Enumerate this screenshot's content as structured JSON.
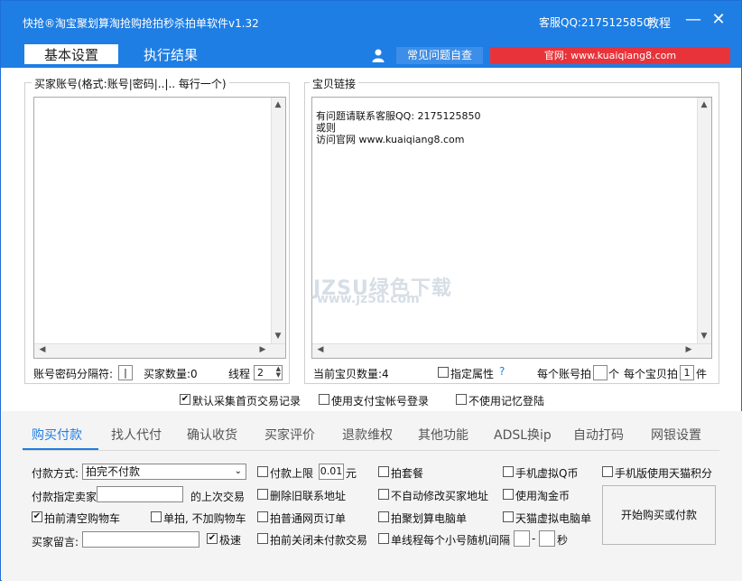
{
  "window": {
    "title": "快抢®淘宝聚划算淘抢购抢拍秒杀拍单软件v1.32",
    "support": "客服QQ:2175125850",
    "tutorial": "教程",
    "minimize": "—",
    "close": "✕"
  },
  "main_tabs": [
    {
      "label": "基本设置"
    },
    {
      "label": "执行结果"
    }
  ],
  "header_links": {
    "faq": "常见问题自查",
    "site": "官网: www.kuaiqiang8.com"
  },
  "accounts": {
    "legend": "买家账号(格式:账号|密码|..|.. 每行一个)",
    "content": "",
    "separator_label": "账号密码分隔符:",
    "separator_value": "|",
    "count_label": "买家数量:0",
    "threads_label": "线程",
    "threads_value": "2"
  },
  "links": {
    "legend": "宝贝链接",
    "content_lines": [
      "有问题请联系客服QQ: 2175125850",
      "或则",
      "访问官网 www.kuaiqiang8.com"
    ],
    "count_label": "当前宝贝数量:4",
    "attr_label": "指定属性",
    "attr_help": "?",
    "per_account_label": "每个账号拍",
    "per_account_unit": "个",
    "per_item_label": "每个宝贝拍",
    "per_item_value": "1",
    "per_item_unit": "件"
  },
  "options_row": {
    "default_collect": "默认采集首页交易记录",
    "alipay_login": "使用支付宝帐号登录",
    "no_memory": "不使用记忆登陆"
  },
  "feature_tabs": [
    {
      "label": "购买付款"
    },
    {
      "label": "找人代付"
    },
    {
      "label": "确认收货"
    },
    {
      "label": "买家评价"
    },
    {
      "label": "退款维权"
    },
    {
      "label": "其他功能"
    },
    {
      "label": "ADSL换ip"
    },
    {
      "label": "自动打码"
    },
    {
      "label": "网银设置"
    }
  ],
  "purchase": {
    "payment_label": "付款方式:",
    "payment_value": "拍完不付款",
    "seller_label": "付款指定卖家",
    "last_trade_label": "的上次交易",
    "clear_cart": "拍前清空购物车",
    "no_cart": "单拍, 不加购物车",
    "message_label": "买家留言:",
    "fast": "极速",
    "pay_limit": "付款上限",
    "pay_limit_value": "0.01",
    "pay_limit_unit": "元",
    "delete_old_addr": "删除旧联系地址",
    "normal_page_order": "拍普通网页订单",
    "close_unpaid": "拍前关闭未付款交易",
    "buy_combo": "拍套餐",
    "no_auto_addr": "不自动修改买家地址",
    "juhuasuan_pc": "拍聚划算电脑单",
    "single_thread": "单线程每个小号随机间隔",
    "interval_sep": "-",
    "interval_unit": "秒",
    "phone_q_coin": "手机虚拟Q币",
    "taojinbi": "使用淘金币",
    "tmall_virtual": "天猫虚拟电脑单",
    "tmall_points": "手机版使用天猫积分",
    "start_button": "开始购买或付款"
  },
  "watermark": {
    "line1": "JZSU绿色下载",
    "line2": "www.jz5u.com"
  },
  "colors": {
    "accent": "#1f7ee3",
    "site_red": "#e8333a"
  }
}
